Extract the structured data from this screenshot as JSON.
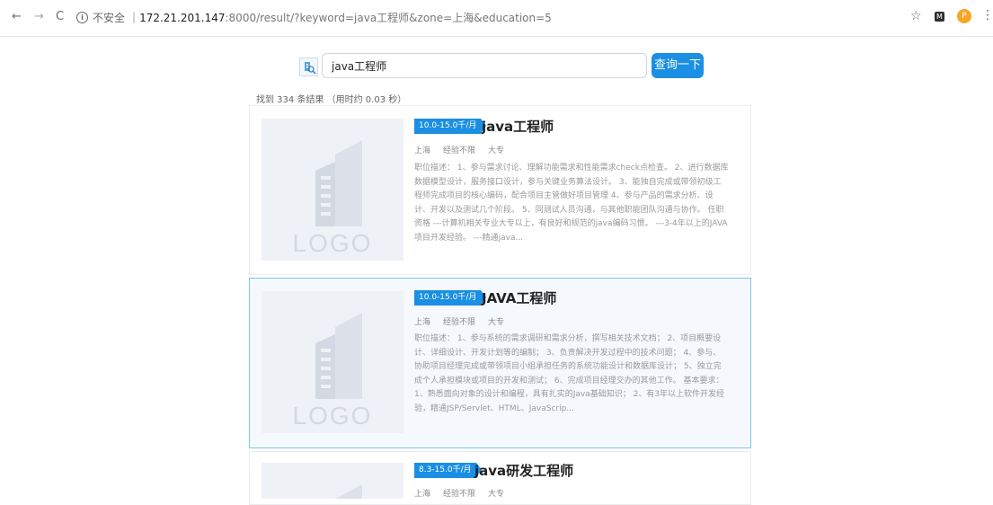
{
  "browser": {
    "back": "←",
    "forward": "→",
    "reload": "C",
    "insecure_label": "不安全",
    "separator": "|",
    "url_host": "172.21.201.147",
    "url_rest": ":8000/result/?keyword=java工程师&zone=上海&education=5",
    "star_icon": "☆",
    "menu_icon": "⋮",
    "avatar_initial": "P"
  },
  "search": {
    "query": "java工程师",
    "button_label": "查询一下",
    "result_summary": "找到 334 条结果 （用时约 0.03 秒）"
  },
  "results": [
    {
      "salary": "10.0-15.0千/月",
      "title": "java工程师",
      "location": "上海",
      "experience": "经验不限",
      "education": "大专",
      "description": "职位描述： 1、参与需求讨论、理解功能需求和性能需求check点检查。 2、进行数据库数据模型设计，服务接口设计，参与关键业务算法设计。 3、能独自完成或带领初级工程师完成项目的核心编码，配合项目主管做好项目管理 4、参与产品的需求分析、设计、开发以及测试几个阶段。 5、同测试人员沟通，与其他职能团队沟通与协作。 任职资格 ---计算机相关专业大专以上，有良好和规范的java编码习惯。 ---3-4年以上的JAVA项目开发经验。 ---精通java..."
    },
    {
      "salary": "10.0-15.0千/月",
      "title": "JAVA工程师",
      "location": "上海",
      "experience": "经验不限",
      "education": "大专",
      "description": "职位描述： 1、参与系统的需求调研和需求分析，撰写相关技术文档； 2、项目概要设计、详细设计、开发计划等的编制； 3、负责解决开发过程中的技术问题； 4、参与、协助项目经理完成或带领项目小组承担任务的系统功能设计和数据库设计； 5、独立完成个人承担模块或项目的开发和测试； 6、完成项目经理交办的其他工作。 基本要求： 1、熟悉面向对象的设计和编程，具有扎实的Java基础知识； 2、有3年以上软件开发经验，精通JSP/Servlet、HTML、JavaScrip..."
    },
    {
      "salary": "8.3-15.0千/月",
      "title": "java研发工程师",
      "location": "上海",
      "experience": "经验不限",
      "education": "大专",
      "description": ""
    }
  ]
}
